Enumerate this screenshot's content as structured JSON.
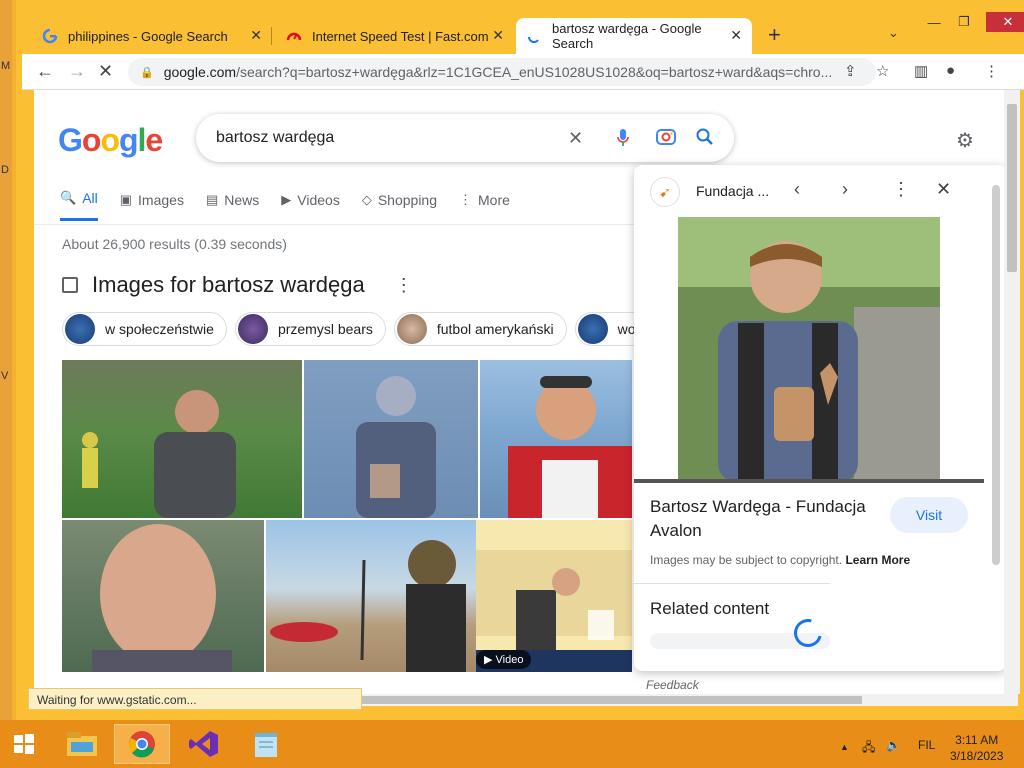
{
  "desktop": {
    "edge_marks": [
      "M",
      "D",
      "V"
    ]
  },
  "tabs": [
    {
      "title": "philippines - Google Search",
      "icon": "google-g-icon"
    },
    {
      "title": "Internet Speed Test | Fast.com",
      "icon": "fastcom-icon"
    },
    {
      "title": "bartosz wardęga - Google Search",
      "icon": "loading-spinner-icon",
      "active": true
    }
  ],
  "toolbar": {
    "url_host": "google.com",
    "url_path": "/search?q=bartosz+wardęga&rlz=1C1GCEA_enUS1028US1028&oq=bartosz+ward&aqs=chro..."
  },
  "google": {
    "logo": "Google",
    "query": "bartosz wardęga",
    "nav_tabs": [
      "All",
      "Images",
      "News",
      "Videos",
      "Shopping",
      "More"
    ],
    "active_tab": "All",
    "stats": "About 26,900 results (0.39 seconds)",
    "images_heading": "Images for bartosz wardęga",
    "chips": [
      "w społeczeństwie",
      "przemysl bears",
      "futbol amerykański",
      "wos"
    ],
    "video_badge": "▶ Video"
  },
  "side_panel": {
    "site": "Fundacja ...",
    "title": "Bartosz Wardęga - Fundacja Avalon",
    "visit_label": "Visit",
    "copyright": "Images may be subject to copyright.",
    "learn_more": "Learn More",
    "related": "Related content"
  },
  "feedback": "Feedback",
  "status_bar": "Waiting for www.gstatic.com...",
  "taskbar": {
    "apps": [
      "file-explorer-icon",
      "chrome-icon",
      "visual-studio-icon",
      "notepad-icon"
    ],
    "active": "chrome-icon",
    "lang": "FIL",
    "time": "3:11 AM",
    "date": "3/18/2023"
  },
  "colors": {
    "accent": "#1a73e8",
    "window": "#fbbf33",
    "taskbar": "#e88e18",
    "close": "#c7303a"
  }
}
